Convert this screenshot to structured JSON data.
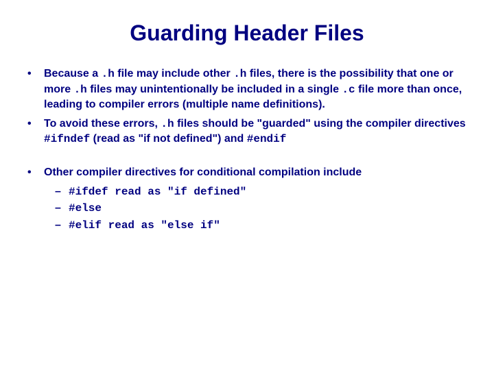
{
  "title": "Guarding Header Files",
  "b1_a": "Because a ",
  "b1_code1": ".h",
  "b1_b": " file may include other ",
  "b1_code2": ".h",
  "b1_c": " files, there is the possibility that one or more ",
  "b1_code3": ".h",
  "b1_d": " files may unintentionally be included in a single ",
  "b1_code4": ".c",
  "b1_e": " file more than once, leading to compiler errors (multiple name definitions).",
  "b2_a": "To avoid these errors, ",
  "b2_code1": ".h",
  "b2_b": " files should be \"guarded\" using the compiler directives ",
  "b2_code2": "#ifndef",
  "b2_c": " (read as \"if not defined\") and ",
  "b2_code3": "#endif",
  "b3": "Other compiler directives for conditional compilation include",
  "s1_code": "#ifdef",
  "s1_txt": " read as \"if defined\"",
  "s2_code": "#else",
  "s3_code": "#elif",
  "s3_txt": " read as \"else if\""
}
